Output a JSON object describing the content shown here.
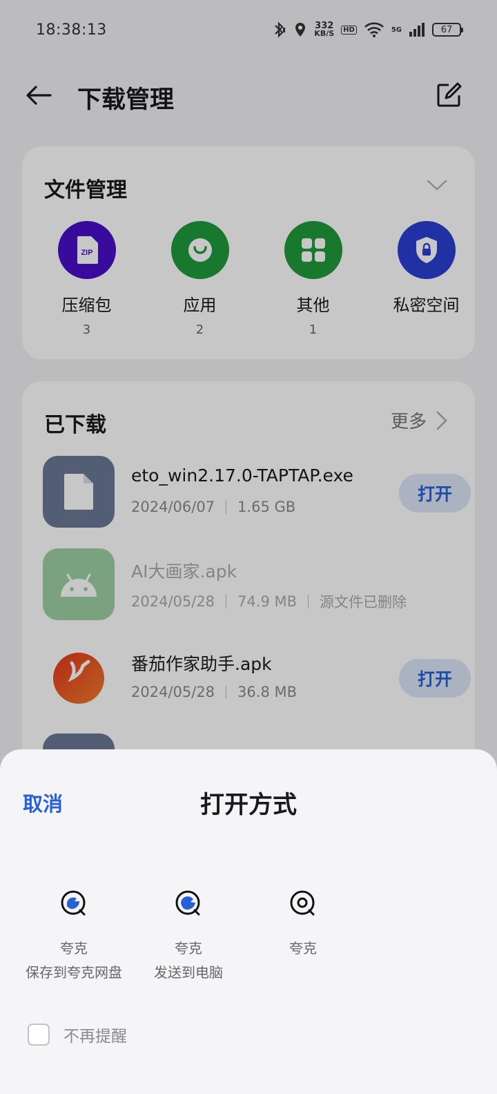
{
  "status_bar": {
    "time": "18:38:13",
    "net_speed_value": "332",
    "net_speed_unit": "KB/S",
    "hd": "HD",
    "net_type": "5G",
    "battery": "67"
  },
  "header": {
    "title": "下载管理"
  },
  "file_manager": {
    "title": "文件管理",
    "categories": [
      {
        "label": "压缩包",
        "count": "3",
        "icon": "zip-icon",
        "color": "#4a0fc9"
      },
      {
        "label": "应用",
        "count": "2",
        "icon": "app-icon",
        "color": "#1f9a3a"
      },
      {
        "label": "其他",
        "count": "1",
        "icon": "grid-icon",
        "color": "#1f9a3a"
      },
      {
        "label": "私密空间",
        "count": "",
        "icon": "lock-shield-icon",
        "color": "#2a3fd1"
      }
    ]
  },
  "downloads": {
    "title": "已下载",
    "more": "更多",
    "open_label": "打开",
    "items": [
      {
        "name": "eto_win2.17.0-TAPTAP.exe",
        "date": "2024/06/07",
        "size": "1.65 GB",
        "status": ""
      },
      {
        "name": "AI大画家.apk",
        "date": "2024/05/28",
        "size": "74.9 MB",
        "status": "源文件已删除"
      },
      {
        "name": "番茄作家助手.apk",
        "date": "2024/05/28",
        "size": "36.8 MB",
        "status": ""
      }
    ]
  },
  "sheet": {
    "cancel": "取消",
    "title": "打开方式",
    "options": [
      {
        "app": "夸克",
        "action": "保存到夸克网盘"
      },
      {
        "app": "夸克",
        "action": "发送到电脑"
      },
      {
        "app": "夸克",
        "action": ""
      }
    ],
    "dont_remind": "不再提醒"
  },
  "colors": {
    "accent": "#2761d8",
    "open_button_bg": "#dbe6f7"
  }
}
